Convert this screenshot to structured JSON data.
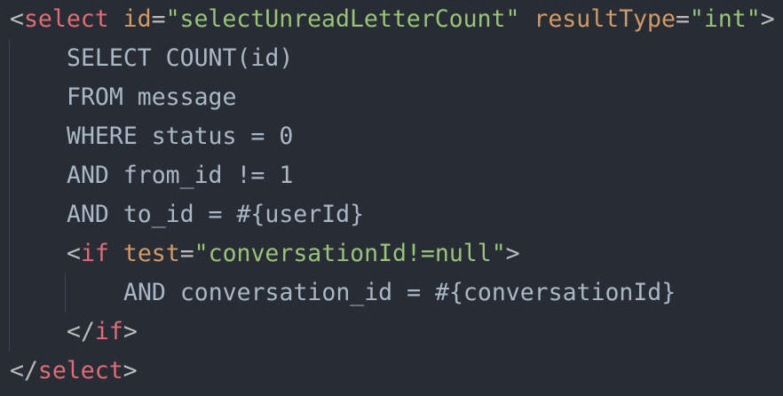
{
  "code": {
    "select_open": {
      "lt": "<",
      "tag": "select",
      "attr1_name": "id",
      "attr1_eq": "=",
      "attr1_value": "\"selectUnreadLetterCount\"",
      "attr2_name": "resultType",
      "attr2_eq": "=",
      "attr2_value": "\"int\"",
      "gt": ">"
    },
    "sql_lines": [
      "SELECT COUNT(id)",
      "FROM message",
      "WHERE status = 0",
      "AND from_id != 1",
      "AND to_id = #{userId}"
    ],
    "if_open": {
      "lt": "<",
      "tag": "if",
      "attr_name": "test",
      "attr_eq": "=",
      "attr_value": "\"conversationId!=null\"",
      "gt": ">"
    },
    "if_body": "AND conversation_id = #{conversationId}",
    "if_close": {
      "lt": "</",
      "tag": "if",
      "gt": ">"
    },
    "select_close": {
      "lt": "</",
      "tag": "select",
      "gt": ">"
    }
  },
  "colors": {
    "background": "#282c34",
    "tag": "#e06c75",
    "attribute": "#d19a66",
    "string": "#98c379",
    "text": "#a9b7c6",
    "indent_guide": "#3e4451"
  }
}
